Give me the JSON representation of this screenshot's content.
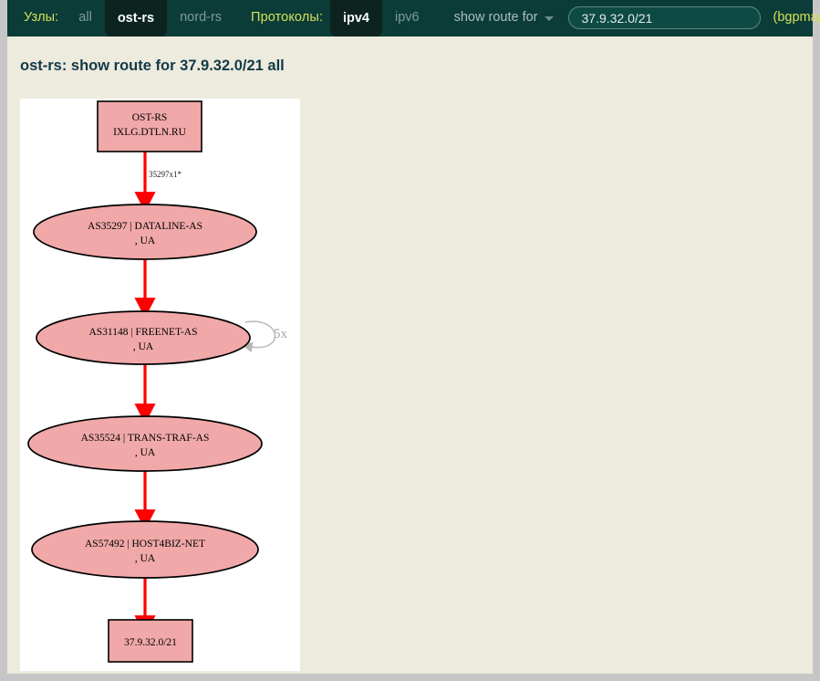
{
  "toolbar": {
    "nodes_label": "Узлы:",
    "node_tabs": [
      {
        "label": "all",
        "active": false
      },
      {
        "label": "ost-rs",
        "active": true
      },
      {
        "label": "nord-rs",
        "active": false
      }
    ],
    "protocols_label": "Протоколы:",
    "protocol_tabs": [
      {
        "label": "ipv4",
        "active": true
      },
      {
        "label": "ipv6",
        "active": false
      }
    ],
    "command_dropdown": "show route for",
    "dropdown_icon": "chevron-down-icon",
    "query_value": "37.9.32.0/21",
    "query_placeholder": "37.9.32.0/21",
    "mode_suffix": "(bgpmap)"
  },
  "page": {
    "title": "ost-rs: show route for 37.9.32.0/21 all"
  },
  "colors": {
    "toolbar_bg": "#0b3c38",
    "toolbar_active_bg": "#0c231f",
    "accent_yellow": "#d4e157",
    "content_bg": "#edeade",
    "title_color": "#123a46",
    "node_fill": "#f0a8a8",
    "node_stroke": "#000000",
    "edge_color": "#ff0000",
    "loop_color": "#b0b0b0"
  },
  "chart_data": {
    "type": "diagram",
    "title": "ost-rs: show route for 37.9.32.0/21 all",
    "layout": "top-to-bottom directed graph",
    "nodes": [
      {
        "id": "router",
        "shape": "box",
        "lines": [
          "OST-RS",
          "IXLG.DTLN.RU"
        ]
      },
      {
        "id": "as35297",
        "shape": "ellipse",
        "lines": [
          "AS35297 | DATALINE-AS",
          ", UA"
        ]
      },
      {
        "id": "as31148",
        "shape": "ellipse",
        "lines": [
          "AS31148 | FREENET-AS",
          ", UA"
        ]
      },
      {
        "id": "as35524",
        "shape": "ellipse",
        "lines": [
          "AS35524 | TRANS-TRAF-AS",
          ", UA"
        ]
      },
      {
        "id": "as57492",
        "shape": "ellipse",
        "lines": [
          "AS57492 | HOST4BIZ-NET",
          ", UA"
        ]
      },
      {
        "id": "prefix",
        "shape": "box",
        "lines": [
          "37.9.32.0/21"
        ]
      }
    ],
    "edges": [
      {
        "from": "router",
        "to": "as35297",
        "label": "35297x1*",
        "color": "#ff0000"
      },
      {
        "from": "as35297",
        "to": "as31148",
        "label": "",
        "color": "#ff0000"
      },
      {
        "from": "as31148",
        "to": "as35524",
        "label": "",
        "color": "#ff0000"
      },
      {
        "from": "as35524",
        "to": "as57492",
        "label": "",
        "color": "#ff0000"
      },
      {
        "from": "as57492",
        "to": "prefix",
        "label": "",
        "color": "#ff0000"
      }
    ],
    "self_loops": [
      {
        "node": "as31148",
        "label": "5x",
        "color": "#b0b0b0"
      }
    ]
  },
  "graph": {
    "node_router_line1": "OST-RS",
    "node_router_line2": "IXLG.DTLN.RU",
    "edge_label_1": "35297x1*",
    "node_as35297_line1": "AS35297 | DATALINE-AS",
    "node_as35297_line2": ", UA",
    "node_as31148_line1": "AS31148 | FREENET-AS",
    "node_as31148_line2": ", UA",
    "self_loop_label": "5x",
    "node_as35524_line1": "AS35524 | TRANS-TRAF-AS",
    "node_as35524_line2": ", UA",
    "node_as57492_line1": "AS57492 | HOST4BIZ-NET",
    "node_as57492_line2": ", UA",
    "node_prefix_line1": "37.9.32.0/21"
  }
}
